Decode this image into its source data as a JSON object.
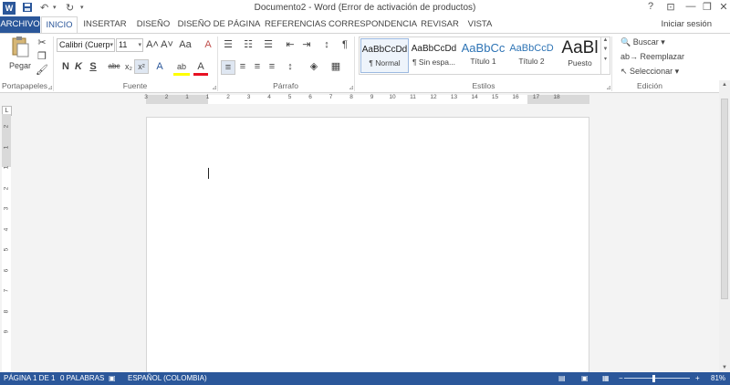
{
  "window": {
    "title": "Documento2 - Word (Error de activación de productos)",
    "controls": {
      "help": "?",
      "ribbon_options": "⊡",
      "minimize": "—",
      "restore": "❐",
      "close": "✕"
    }
  },
  "quick_access": {
    "app_icon": "W",
    "save": "💾",
    "undo": "↶",
    "redo": "↻",
    "customize": "▾"
  },
  "tabs": {
    "file": "ARCHIVO",
    "home": "INICIO",
    "insert": "INSERTAR",
    "design": "DISEÑO",
    "layout": "DISEÑO DE PÁGINA",
    "references": "REFERENCIAS",
    "mailings": "CORRESPONDENCIA",
    "review": "REVISAR",
    "view": "VISTA"
  },
  "signin": "Iniciar sesión",
  "ribbon": {
    "clipboard": {
      "paste_label": "Pegar",
      "group_label": "Portapapeles"
    },
    "font": {
      "font_name": "Calibri (Cuerp",
      "font_size": "11",
      "grow": "A˄",
      "shrink": "A˅",
      "case": "Aa",
      "clear": "A",
      "bold": "N",
      "italic": "K",
      "underline": "S",
      "strike": "abc",
      "subscript": "x₂",
      "superscript": "x²",
      "effects": "A",
      "highlight": "ab",
      "color": "A",
      "group_label": "Fuente"
    },
    "paragraph": {
      "pilcrow": "¶",
      "sort": "↕",
      "group_label": "Párrafo"
    },
    "styles": {
      "items": [
        {
          "sample": "AaBbCcDd",
          "name": "¶ Normal"
        },
        {
          "sample": "AaBbCcDd",
          "name": "¶ Sin espa..."
        },
        {
          "sample": "AaBbCc",
          "name": "Título 1"
        },
        {
          "sample": "AaBbCcD",
          "name": "Título 2"
        },
        {
          "sample": "AaBl",
          "name": "Puesto"
        }
      ],
      "group_label": "Estilos"
    },
    "editing": {
      "find": "Buscar",
      "replace": "Reemplazar",
      "select": "Seleccionar",
      "group_label": "Edición"
    }
  },
  "ruler": {
    "h_numbers": [
      "3",
      "2",
      "1",
      "1",
      "2",
      "3",
      "4",
      "5",
      "6",
      "7",
      "8",
      "9",
      "10",
      "11",
      "12",
      "13",
      "14",
      "15",
      "16",
      "17",
      "18"
    ],
    "v_numbers": [
      "2",
      "1",
      "1",
      "2",
      "3",
      "4",
      "5",
      "6",
      "7",
      "8",
      "9"
    ],
    "tab_selector": "L"
  },
  "status_bar": {
    "page": "PÁGINA 1 DE 1",
    "words": "0 PALABRAS",
    "language": "ESPAÑOL (COLOMBIA)",
    "zoom_out": "−",
    "zoom_in": "+",
    "zoom": "81%"
  },
  "colors": {
    "accent": "#2b579a",
    "highlight": "#ffff00",
    "font_color": "#e81123"
  }
}
